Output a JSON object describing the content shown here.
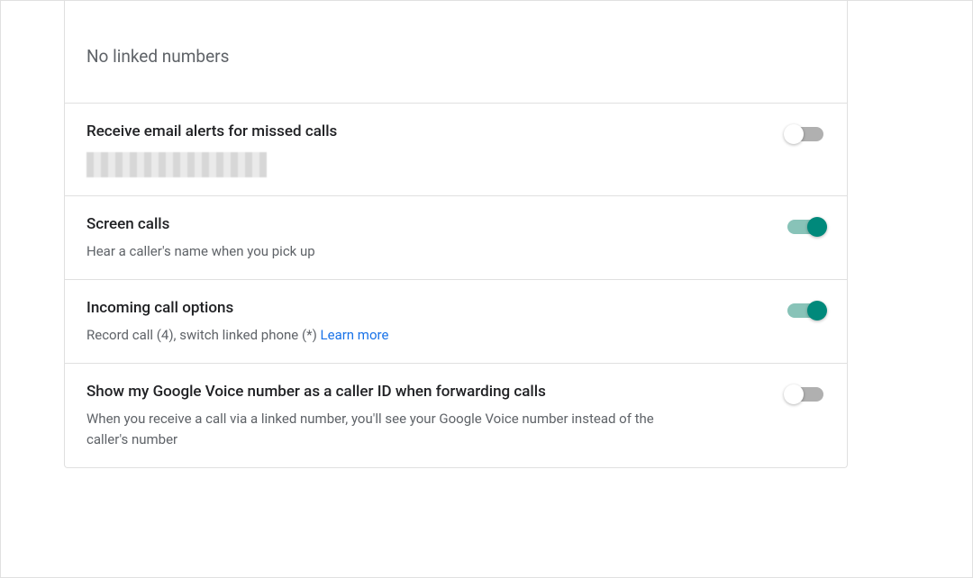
{
  "linked_numbers": {
    "header": "No linked numbers"
  },
  "settings": {
    "email_alerts": {
      "title": "Receive email alerts for missed calls",
      "enabled": false
    },
    "screen_calls": {
      "title": "Screen calls",
      "description": "Hear a caller's name when you pick up",
      "enabled": true
    },
    "incoming_options": {
      "title": "Incoming call options",
      "description": "Record call (4), switch linked phone (*) ",
      "learn_more": "Learn more",
      "enabled": true
    },
    "caller_id": {
      "title": "Show my Google Voice number as a caller ID when forwarding calls",
      "description": "When you receive a call via a linked number, you'll see your Google Voice number instead of the caller's number",
      "enabled": false
    }
  },
  "colors": {
    "toggle_on_knob": "#00897b",
    "toggle_on_track": "#88c3b8",
    "toggle_off_track": "#b0b0b0",
    "toggle_off_knob": "#ffffff",
    "link": "#1a73e8"
  }
}
